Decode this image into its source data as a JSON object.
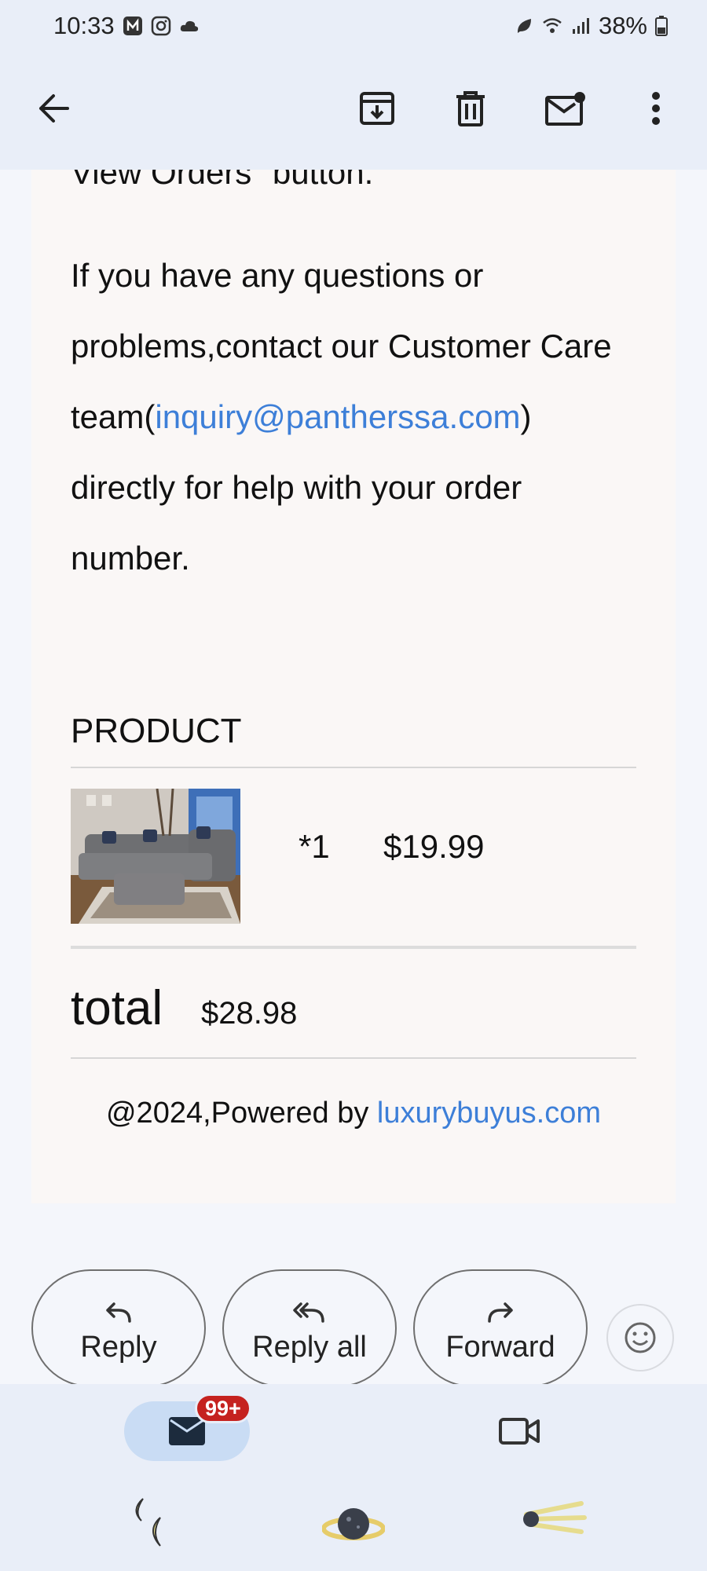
{
  "status_bar": {
    "time": "10:33",
    "battery": "38%"
  },
  "app_bar": {
    "back": "back-arrow-icon",
    "archive": "archive-icon",
    "delete": "trash-icon",
    "mark_unread": "mark-unread-icon",
    "more": "more-vert-icon"
  },
  "email": {
    "cut_off_line": "View Orders\" button.",
    "paragraph_before": "If you have any questions or problems,contact our Customer Care team(",
    "support_email": "inquiry@pantherssa.com",
    "paragraph_after": ") directly for help with your order number.",
    "product_heading": "PRODUCT",
    "product": {
      "image": "sectional-sofa-photo",
      "quantity": "*1",
      "price": "$19.99"
    },
    "total_label": "total",
    "total_value": "$28.98",
    "footer_prefix": "@2024,Powered by ",
    "footer_link": "luxurybuyus.com"
  },
  "actions": {
    "reply": "Reply",
    "reply_all": "Reply all",
    "forward": "Forward",
    "emoji": "emoji-react-icon"
  },
  "bottom_nav": {
    "mail_badge": "99+",
    "mail": "mail-icon",
    "meet": "video-camera-icon"
  },
  "colors": {
    "link": "#3d7fd8",
    "chrome": "#e9eef8",
    "badge": "#c5221f",
    "selected_tab": "#c9dcf4"
  }
}
